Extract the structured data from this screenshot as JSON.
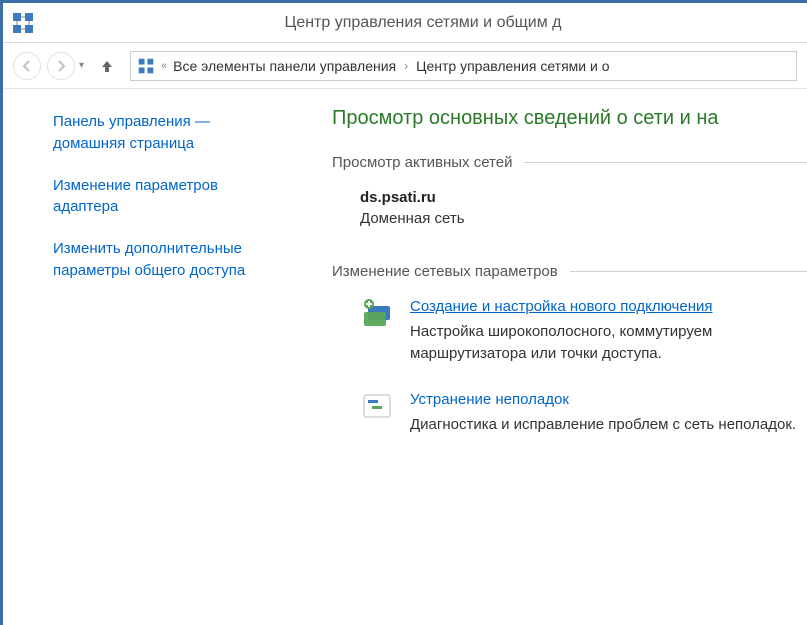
{
  "window": {
    "title": "Центр управления сетями и общим д"
  },
  "breadcrumb": {
    "seg1": "Все элементы панели управления",
    "seg2": "Центр управления сетями и о"
  },
  "sidebar": {
    "home": "Панель управления — домашняя страница",
    "adapter": "Изменение параметров адаптера",
    "sharing": "Изменить дополнительные параметры общего доступа"
  },
  "main": {
    "title": "Просмотр основных сведений о сети и на",
    "active_label": "Просмотр активных сетей",
    "network": {
      "name": "ds.psati.ru",
      "type": "Доменная сеть"
    },
    "change_label": "Изменение сетевых параметров",
    "task_create": {
      "link": "Создание и настройка нового подключения",
      "desc": "Настройка широкополосного, коммутируем маршрутизатора или точки доступа."
    },
    "task_troubleshoot": {
      "link": "Устранение неполадок",
      "desc": "Диагностика и исправление проблем с сеть неполадок."
    }
  }
}
